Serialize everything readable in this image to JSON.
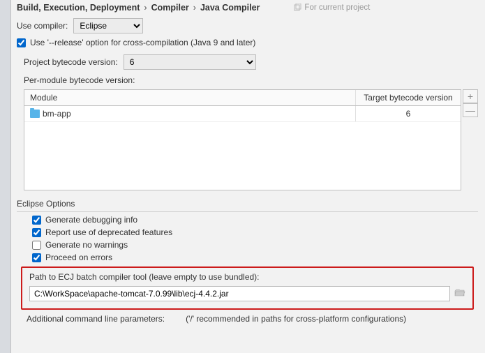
{
  "breadcrumb": {
    "a": "Build, Execution, Deployment",
    "b": "Compiler",
    "c": "Java Compiler"
  },
  "header": {
    "for_project": "For current project"
  },
  "compiler": {
    "label": "Use compiler:",
    "selected": "Eclipse"
  },
  "release_option": {
    "label": "Use '--release' option for cross-compilation (Java 9 and later)"
  },
  "bytecode": {
    "label": "Project bytecode version:",
    "selected": "6"
  },
  "per_module": {
    "label": "Per-module bytecode version:",
    "col_module": "Module",
    "col_target": "Target bytecode version",
    "rows": [
      {
        "module": "bm-app",
        "target": "6"
      }
    ]
  },
  "eclipse_options": {
    "title": "Eclipse Options",
    "debug": "Generate debugging info",
    "deprecated": "Report use of deprecated features",
    "no_warn": "Generate no warnings",
    "proceed": "Proceed on errors"
  },
  "ecj": {
    "label": "Path to ECJ batch compiler tool (leave empty to use bundled):",
    "value": "C:\\WorkSpace\\apache-tomcat-7.0.99\\lib\\ecj-4.4.2.jar"
  },
  "additional": {
    "label": "Additional command line parameters:",
    "hint": "('/' recommended in paths for cross-platform configurations)"
  }
}
